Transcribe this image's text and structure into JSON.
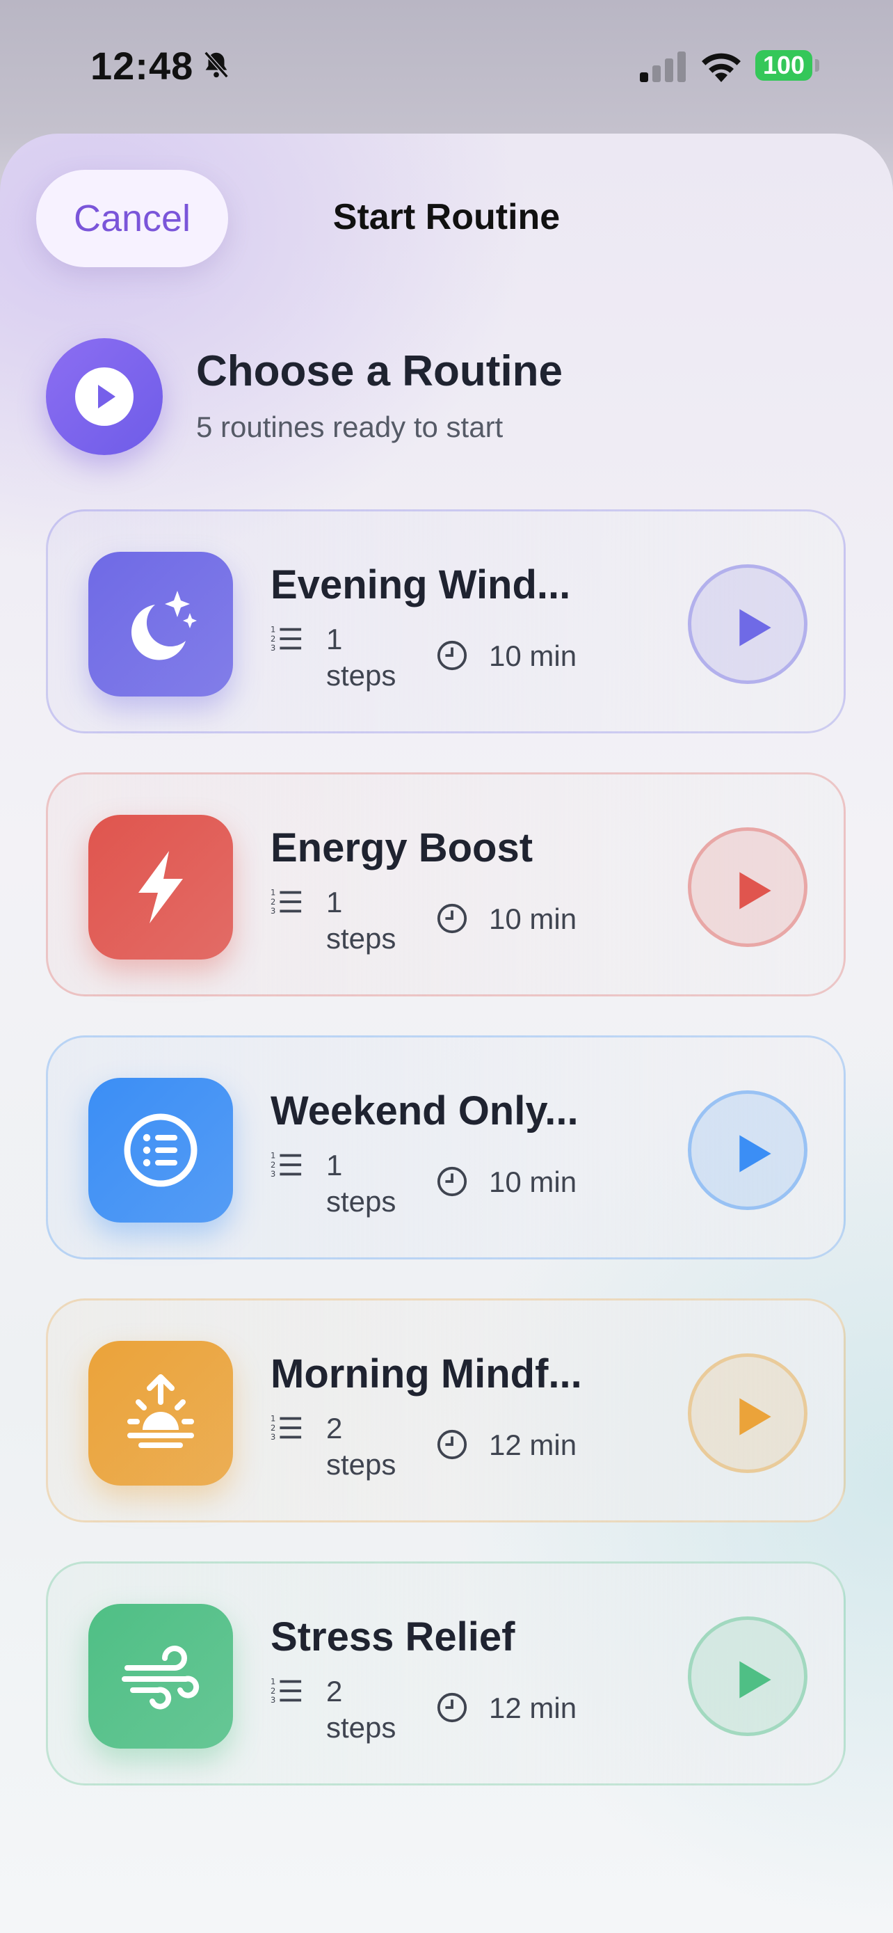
{
  "status_bar": {
    "time": "12:48",
    "battery": "100"
  },
  "header": {
    "cancel_label": "Cancel",
    "title": "Start Routine"
  },
  "hero": {
    "title": "Choose a Routine",
    "subtitle": "5 routines ready to start"
  },
  "routines": [
    {
      "title": "Evening Wind...",
      "steps": "1",
      "steps_label": "steps",
      "duration": "10 min",
      "icon": "moon-stars-icon",
      "color": "#6f6ae6"
    },
    {
      "title": "Energy Boost",
      "steps": "1",
      "steps_label": "steps",
      "duration": "10 min",
      "icon": "lightning-icon",
      "color": "#e0554e"
    },
    {
      "title": "Weekend Only...",
      "steps": "1",
      "steps_label": "steps",
      "duration": "10 min",
      "icon": "list-icon",
      "color": "#3b8ef5"
    },
    {
      "title": "Morning Mindf...",
      "steps": "2",
      "steps_label": "steps",
      "duration": "12 min",
      "icon": "sunrise-icon",
      "color": "#eba33a"
    },
    {
      "title": "Stress Relief",
      "steps": "2",
      "steps_label": "steps",
      "duration": "12 min",
      "icon": "wind-icon",
      "color": "#4fbf85"
    }
  ],
  "colors": {
    "accent": "#7a55d9"
  }
}
